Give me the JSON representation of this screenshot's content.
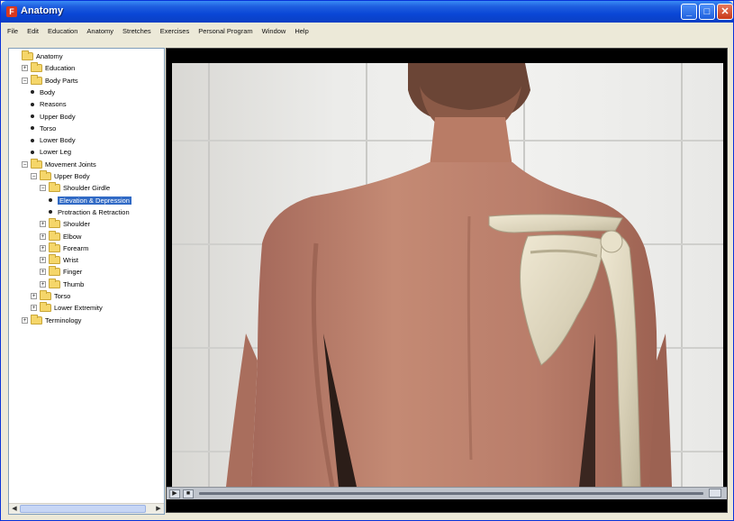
{
  "window": {
    "title": "Anatomy",
    "app_icon_glyph": "F",
    "buttons": {
      "minimize": "_",
      "maximize": "□",
      "close": "✕"
    }
  },
  "menu": [
    "File",
    "Edit",
    "Education",
    "Anatomy",
    "Stretches",
    "Exercises",
    "Personal Program",
    "Window",
    "Help"
  ],
  "tree": {
    "nodes": [
      {
        "label": "Anatomy",
        "icon": "folder-icon",
        "expander": "",
        "depth": 0
      },
      {
        "label": "Education",
        "icon": "folder-icon",
        "expander": "+",
        "depth": 1
      },
      {
        "label": "Body Parts",
        "icon": "folder-icon",
        "expander": "−",
        "depth": 1
      },
      {
        "label": "Body",
        "icon": "bullet",
        "expander": "",
        "depth": 2
      },
      {
        "label": "Reasons",
        "icon": "bullet",
        "expander": "",
        "depth": 2
      },
      {
        "label": "Upper Body",
        "icon": "bullet",
        "expander": "",
        "depth": 2
      },
      {
        "label": "Torso",
        "icon": "bullet",
        "expander": "",
        "depth": 2
      },
      {
        "label": "Lower Body",
        "icon": "bullet",
        "expander": "",
        "depth": 2
      },
      {
        "label": "Lower Leg",
        "icon": "bullet",
        "expander": "",
        "depth": 2
      },
      {
        "label": "Movement Joints",
        "icon": "folder-icon",
        "expander": "−",
        "depth": 1
      },
      {
        "label": "Upper Body",
        "icon": "folder-icon",
        "expander": "−",
        "depth": 2
      },
      {
        "label": "Shoulder Girdle",
        "icon": "folder-icon",
        "expander": "−",
        "depth": 3
      },
      {
        "label": "Elevation & Depression",
        "icon": "bullet",
        "expander": "",
        "depth": 4,
        "selected": true
      },
      {
        "label": "Protraction & Retraction",
        "icon": "bullet",
        "expander": "",
        "depth": 4
      },
      {
        "label": "Shoulder",
        "icon": "folder-icon",
        "expander": "+",
        "depth": 3
      },
      {
        "label": "Elbow",
        "icon": "folder-icon",
        "expander": "+",
        "depth": 3
      },
      {
        "label": "Forearm",
        "icon": "folder-icon",
        "expander": "+",
        "depth": 3
      },
      {
        "label": "Wrist",
        "icon": "folder-icon",
        "expander": "+",
        "depth": 3
      },
      {
        "label": "Finger",
        "icon": "folder-icon",
        "expander": "+",
        "depth": 3
      },
      {
        "label": "Thumb",
        "icon": "folder-icon",
        "expander": "+",
        "depth": 3
      },
      {
        "label": "Torso",
        "icon": "folder-icon",
        "expander": "+",
        "depth": 2
      },
      {
        "label": "Lower Extremity",
        "icon": "folder-icon",
        "expander": "+",
        "depth": 2
      },
      {
        "label": "Terminology",
        "icon": "folder-icon",
        "expander": "+",
        "depth": 1
      }
    ]
  },
  "video": {
    "controls": {
      "play": "▶",
      "stop": "■"
    }
  },
  "colors": {
    "titlebar": "#0a47d6",
    "selection": "#316ac5",
    "skin": "#c48a74",
    "bone": "#e4ddc6"
  }
}
